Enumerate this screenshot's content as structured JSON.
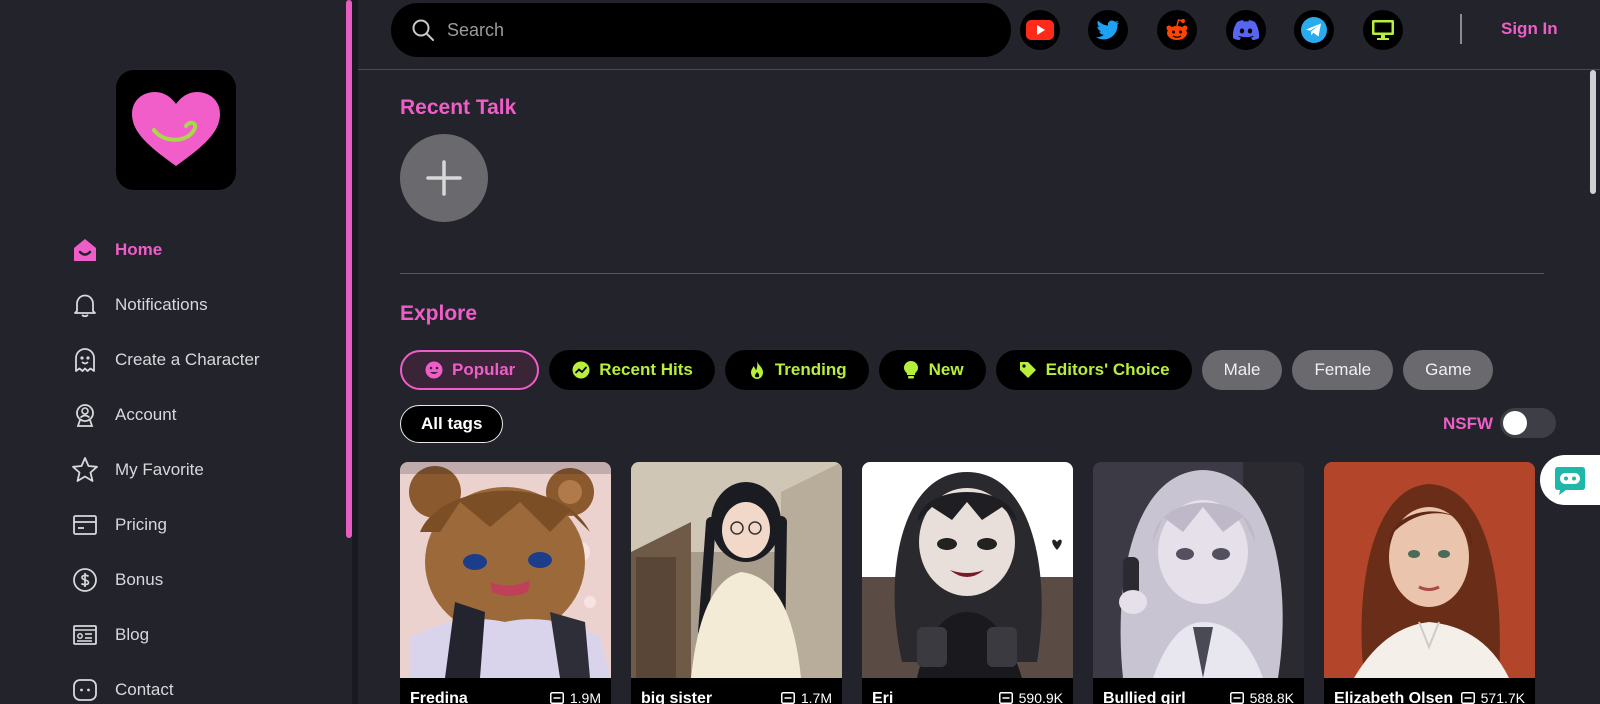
{
  "sidebar": {
    "logo_icon": "heart-logo-icon",
    "items": [
      {
        "label": "Home",
        "icon": "home-icon",
        "active": true
      },
      {
        "label": "Notifications",
        "icon": "bell-icon"
      },
      {
        "label": "Create a Character",
        "icon": "ghost-icon"
      },
      {
        "label": "Account",
        "icon": "user-badge-icon"
      },
      {
        "label": "My Favorite",
        "icon": "star-icon"
      },
      {
        "label": "Pricing",
        "icon": "card-icon"
      },
      {
        "label": "Bonus",
        "icon": "dollar-coin-icon"
      },
      {
        "label": "Blog",
        "icon": "blog-icon"
      },
      {
        "label": "Contact",
        "icon": "chat-icon"
      }
    ]
  },
  "header": {
    "search_placeholder": "Search",
    "social": [
      "youtube-icon",
      "twitter-icon",
      "reddit-icon",
      "discord-icon",
      "telegram-icon",
      "desktop-icon"
    ],
    "sign_in": "Sign In"
  },
  "recent_talk": {
    "title": "Recent Talk"
  },
  "explore": {
    "title": "Explore",
    "tags": [
      {
        "label": "Popular",
        "style": "selected",
        "icon": "smiley-icon"
      },
      {
        "label": "Recent Hits",
        "style": "dark",
        "icon": "trend-icon"
      },
      {
        "label": "Trending",
        "style": "dark",
        "icon": "flame-icon"
      },
      {
        "label": "New",
        "style": "dark",
        "icon": "bulb-icon"
      },
      {
        "label": "Editors' Choice",
        "style": "dark",
        "icon": "tag-icon"
      },
      {
        "label": "Male",
        "style": "grey"
      },
      {
        "label": "Female",
        "style": "grey"
      },
      {
        "label": "Game",
        "style": "grey"
      }
    ],
    "all_tags": "All tags",
    "nsfw_label": "NSFW",
    "nsfw_on": false
  },
  "cards": [
    {
      "name": "Fredina",
      "count": "1.9M"
    },
    {
      "name": "big sister",
      "count": "1.7M"
    },
    {
      "name": "Eri",
      "count": "590.9K"
    },
    {
      "name": "Bullied girl",
      "count": "588.8K"
    },
    {
      "name": "Elizabeth Olsen",
      "count": "571.7K"
    }
  ],
  "colors": {
    "accent": "#ef5ec8",
    "tag_text": "#b8ef3a",
    "background": "#22232b"
  }
}
